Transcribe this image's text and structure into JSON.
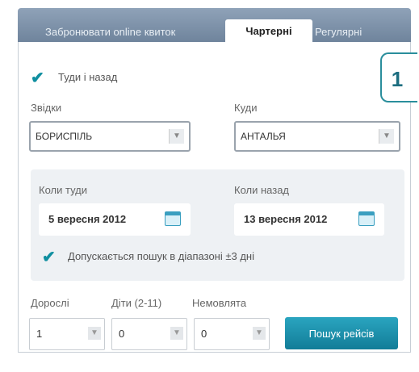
{
  "tabs": [
    {
      "label": "Забронювати online квиток"
    },
    {
      "label": "Чартерні"
    },
    {
      "label": "Регулярні"
    }
  ],
  "badge": "1",
  "round_trip": {
    "label": "Туди і назад",
    "checked": true
  },
  "from": {
    "label": "Звідки",
    "value": "БОРИСПІЛЬ"
  },
  "to": {
    "label": "Куди",
    "value": "АНТАЛЬЯ"
  },
  "depart": {
    "label": "Коли туди",
    "value": "5 вересня 2012"
  },
  "return": {
    "label": "Коли назад",
    "value": "13 вересня 2012"
  },
  "range": {
    "label": "Допускається пошук в діапазоні ±3 дні",
    "checked": true
  },
  "passengers": {
    "adults": {
      "label": "Дорослі",
      "value": "1"
    },
    "children": {
      "label": "Діти (2-11)",
      "value": "0"
    },
    "infants": {
      "label": "Немовлята",
      "value": "0"
    }
  },
  "search_button": "Пошук рейсів",
  "colors": {
    "accent": "#127d98",
    "tab_bar": "#7f93aa",
    "check": "#0f8fa0"
  }
}
